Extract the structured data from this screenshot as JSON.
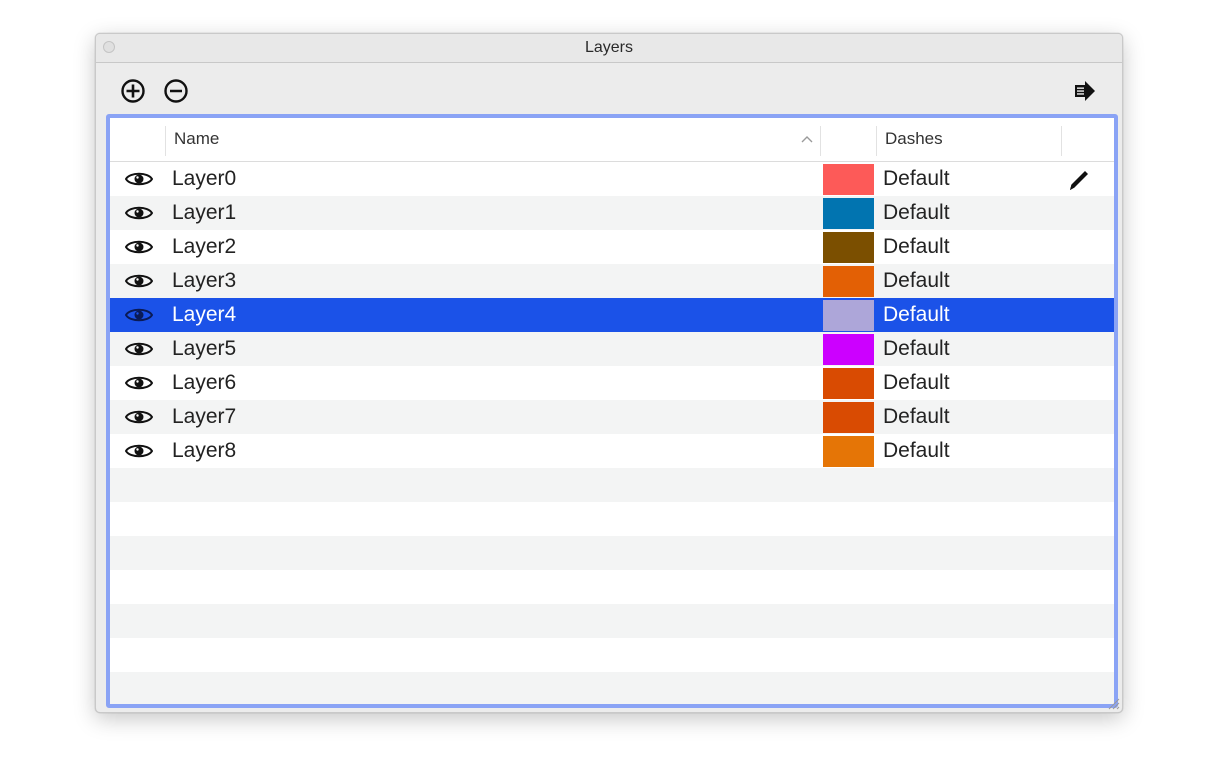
{
  "window": {
    "title": "Layers"
  },
  "toolbar": {
    "add_icon": "add-circle-icon",
    "remove_icon": "remove-circle-icon",
    "export_icon": "export-arrow-icon"
  },
  "table": {
    "columns": {
      "name": "Name",
      "dashes": "Dashes"
    },
    "sort_indicator": "^",
    "rows": [
      {
        "name": "Layer0",
        "color": "#fd5a58",
        "dashes": "Default",
        "active": true
      },
      {
        "name": "Layer1",
        "color": "#0174b0",
        "dashes": "Default"
      },
      {
        "name": "Layer2",
        "color": "#7b4f00",
        "dashes": "Default"
      },
      {
        "name": "Layer3",
        "color": "#e36005",
        "dashes": "Default"
      },
      {
        "name": "Layer4",
        "color": "#ada6d9",
        "dashes": "Default",
        "selected": true
      },
      {
        "name": "Layer5",
        "color": "#cc00ff",
        "dashes": "Default"
      },
      {
        "name": "Layer6",
        "color": "#d94b02",
        "dashes": "Default"
      },
      {
        "name": "Layer7",
        "color": "#d94b02",
        "dashes": "Default"
      },
      {
        "name": "Layer8",
        "color": "#e57506",
        "dashes": "Default"
      }
    ]
  },
  "colors": {
    "selection": "#1b52e8",
    "focus_ring": "#8aa3f5",
    "stripe": "#f3f4f4"
  }
}
